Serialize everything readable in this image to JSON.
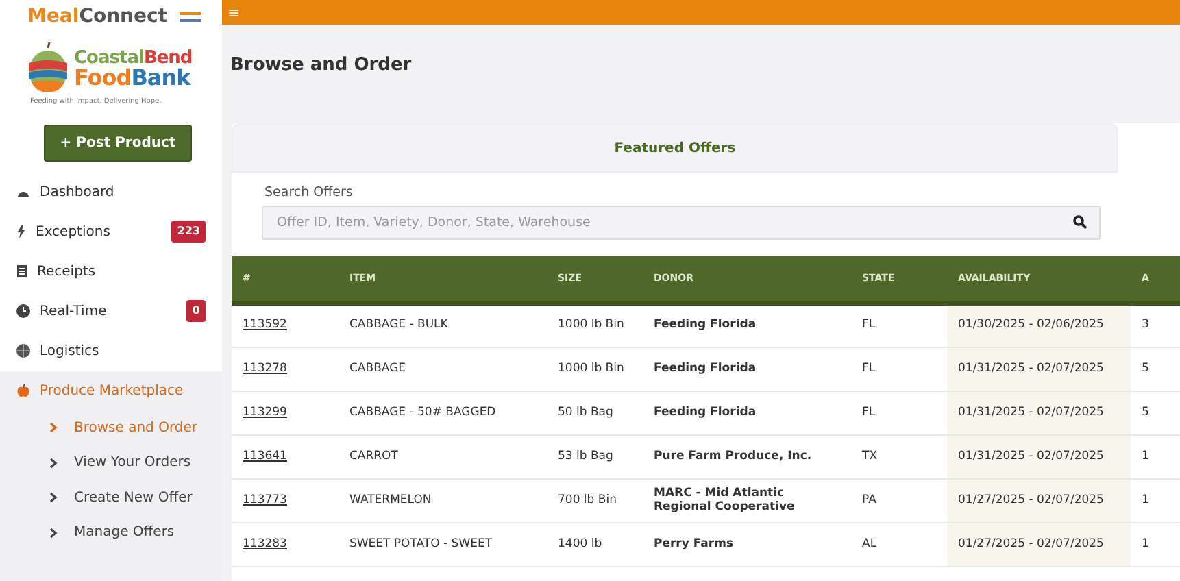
{
  "brand": {
    "app_name_part1": "Meal",
    "app_name_part2": "Connect",
    "org_line1_part1": "Coastal",
    "org_line1_part2": "Bend",
    "org_line2_part1": "Food",
    "org_line2_part2": "Bank",
    "tagline": "Feeding with Impact. Delivering Hope."
  },
  "post_button": {
    "icon": "+",
    "label": "Post Product"
  },
  "sidebar": {
    "items": [
      {
        "kind": "main",
        "label": "Dashboard",
        "selected": false
      },
      {
        "kind": "main",
        "label": "Exceptions",
        "badge": "223",
        "selected": false
      },
      {
        "kind": "main",
        "label": "Receipts",
        "selected": false
      },
      {
        "kind": "main",
        "label": "Real-Time",
        "badge": "0",
        "selected": false
      },
      {
        "kind": "main",
        "label": "Logistics",
        "selected": false
      },
      {
        "kind": "section",
        "label": "Produce Marketplace",
        "selected": true,
        "children": [
          {
            "label": "Browse and Order",
            "selected": true
          },
          {
            "label": "View Your Orders",
            "selected": false
          },
          {
            "label": "Create New Offer",
            "selected": false
          },
          {
            "label": "Manage Offers",
            "selected": false
          }
        ]
      }
    ]
  },
  "topbar": {
    "menu_icon": "≡"
  },
  "page_title": "Browse and Order",
  "tabs": [
    {
      "label": "Featured Offers",
      "selected": false
    }
  ],
  "search": {
    "label": "Search Offers",
    "placeholder": "Offer ID, Item, Variety, Donor, State, Warehouse"
  },
  "table": {
    "columns": [
      "#",
      "ITEM",
      "SIZE",
      "DONOR",
      "STATE",
      "AVAILABILITY",
      "A"
    ],
    "rows": [
      [
        "113592",
        "CABBAGE - BULK",
        "1000 lb Bin",
        "Feeding Florida",
        "FL",
        "01/30/2025 - 02/06/2025",
        "3"
      ],
      [
        "113278",
        "CABBAGE",
        "1000 lb Bin",
        "Feeding Florida",
        "FL",
        "01/31/2025 - 02/07/2025",
        "5"
      ],
      [
        "113299",
        "CABBAGE - 50# BAGGED",
        "50 lb Bag",
        "Feeding Florida",
        "FL",
        "01/31/2025 - 02/07/2025",
        "5"
      ],
      [
        "113641",
        "CARROT",
        "53 lb Bag",
        "Pure Farm Produce, Inc.",
        "TX",
        "01/31/2025 - 02/07/2025",
        "1"
      ],
      [
        "113773",
        "WATERMELON",
        "700 lb Bin",
        "MARC - Mid Atlantic Regional Cooperative",
        "PA",
        "01/27/2025 - 02/07/2025",
        "1"
      ],
      [
        "113283",
        "SWEET POTATO - SWEET",
        "1400 lb",
        "Perry Farms",
        "AL",
        "01/27/2025 - 02/07/2025",
        "1"
      ]
    ]
  }
}
